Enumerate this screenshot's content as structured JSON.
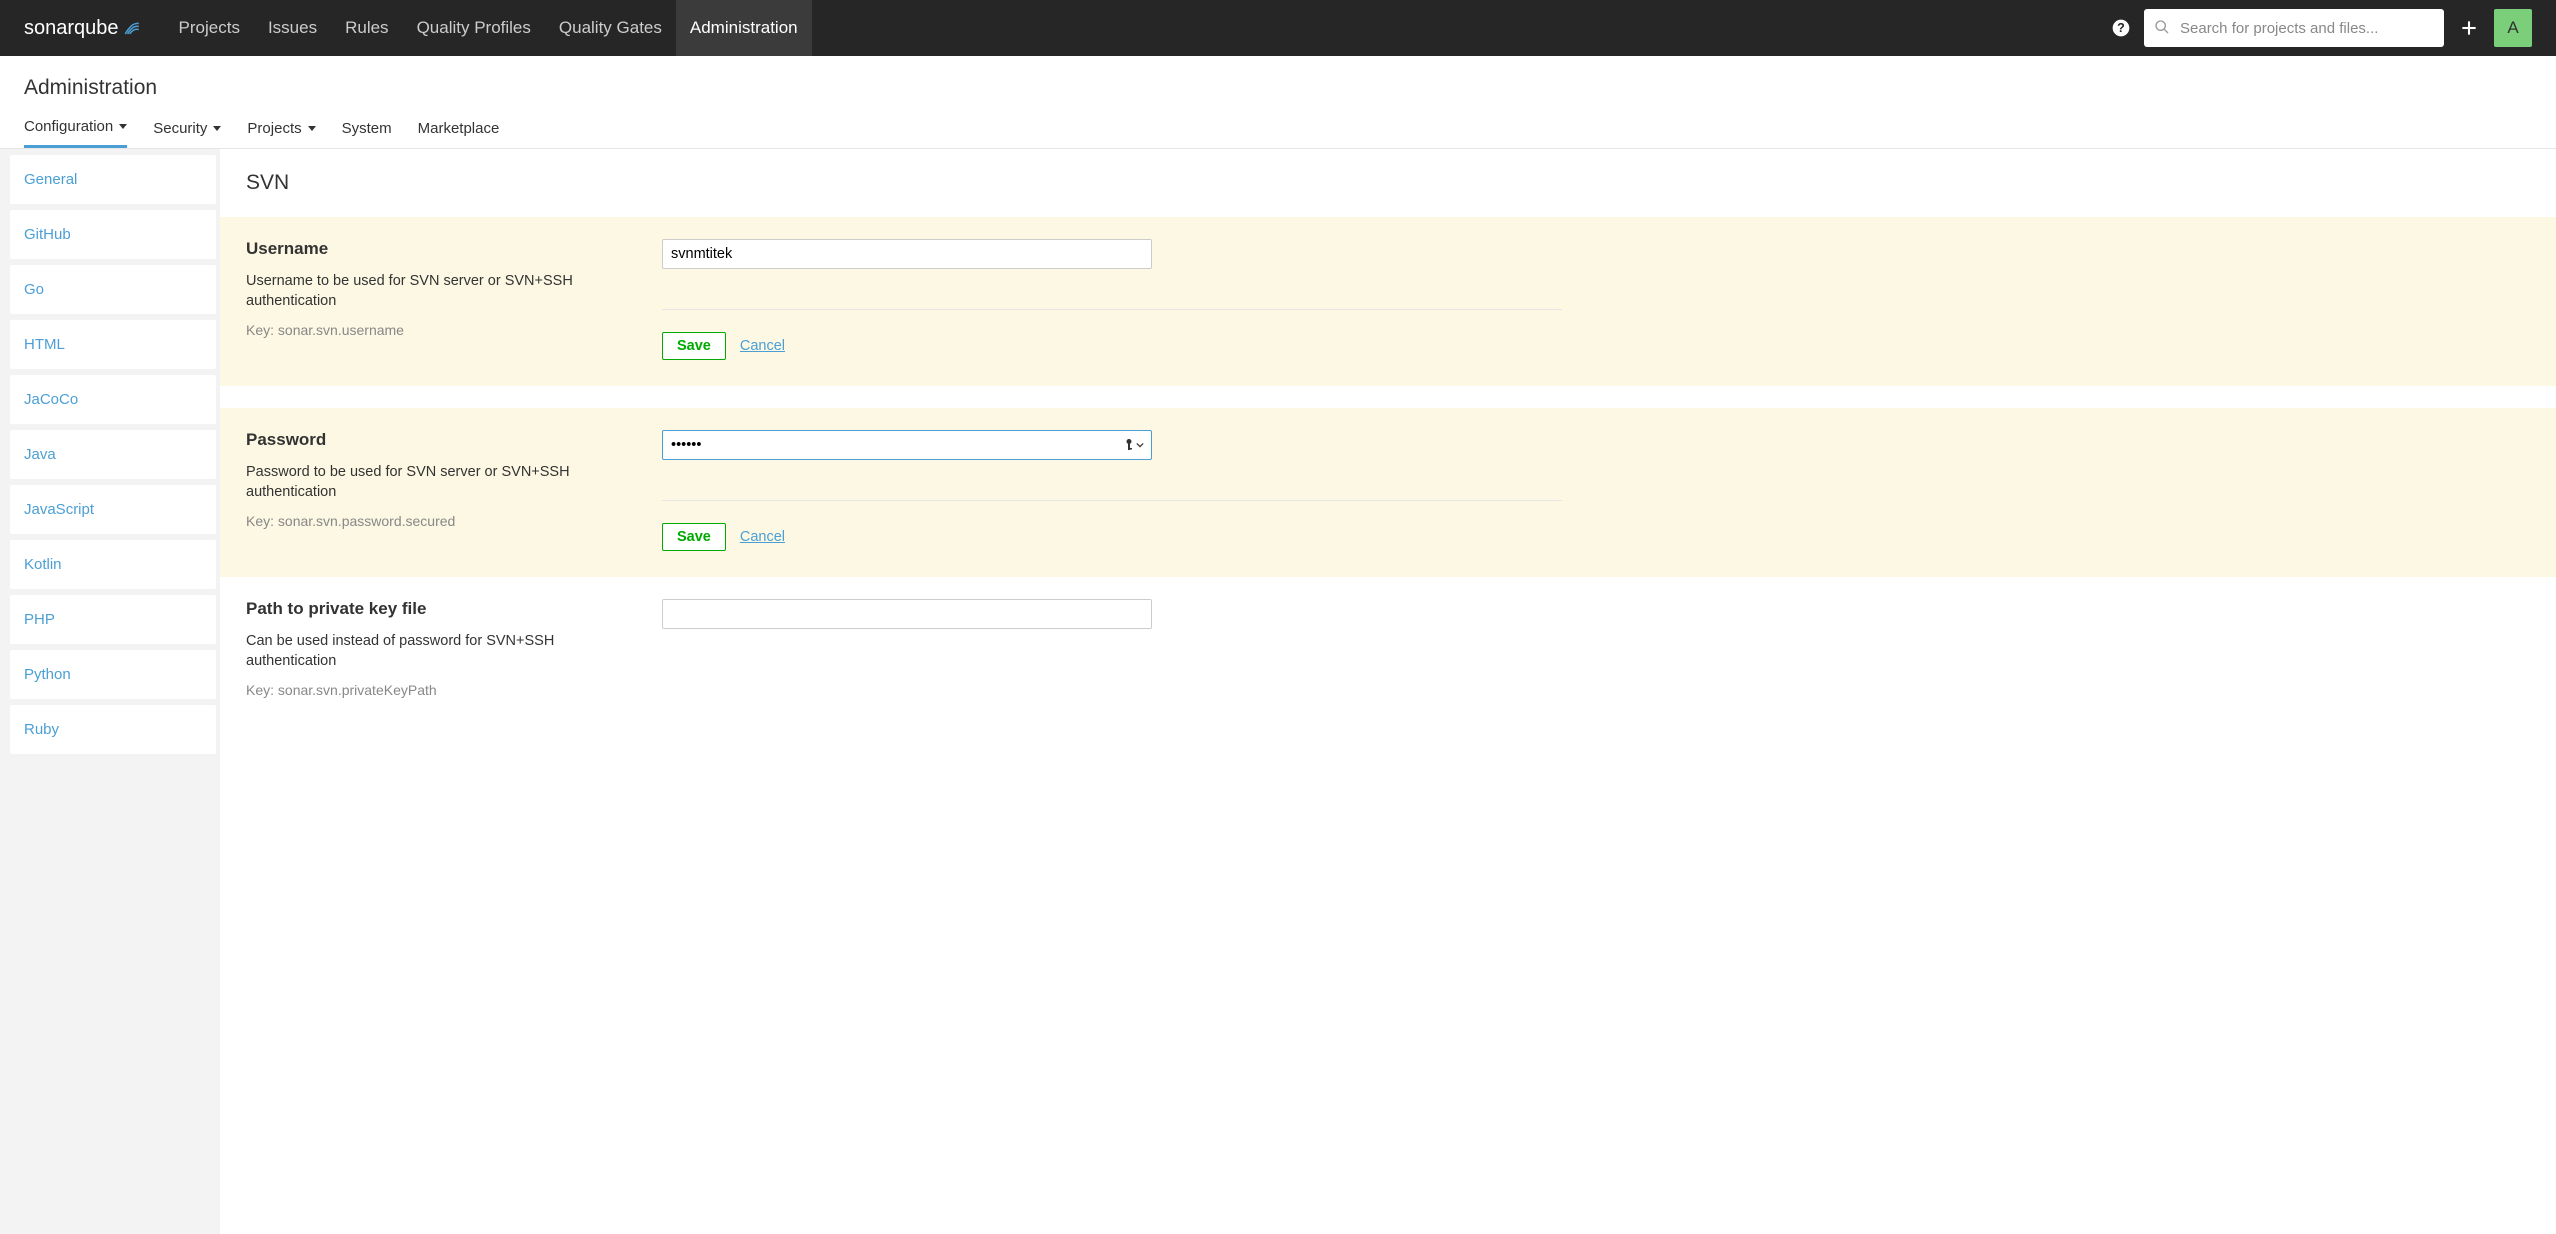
{
  "topnav": {
    "logo": {
      "part1": "sonar",
      "part2": "qube"
    },
    "links": [
      "Projects",
      "Issues",
      "Rules",
      "Quality Profiles",
      "Quality Gates",
      "Administration"
    ],
    "active_index": 5,
    "search_placeholder": "Search for projects and files...",
    "avatar_letter": "A"
  },
  "page": {
    "title": "Administration",
    "tabs": [
      {
        "label": "Configuration",
        "caret": true,
        "active": true
      },
      {
        "label": "Security",
        "caret": true
      },
      {
        "label": "Projects",
        "caret": true
      },
      {
        "label": "System"
      },
      {
        "label": "Marketplace"
      }
    ]
  },
  "sidebar": {
    "items": [
      "General",
      "GitHub",
      "Go",
      "HTML",
      "JaCoCo",
      "Java",
      "JavaScript",
      "Kotlin",
      "PHP",
      "Python",
      "Ruby"
    ]
  },
  "section": {
    "title": "SVN"
  },
  "settings": [
    {
      "highlighted": true,
      "name": "Username",
      "desc": "Username to be used for SVN server or SVN+SSH authentication",
      "key_label": "Key: sonar.svn.username",
      "value": "svnmtitek",
      "type": "text",
      "save": "Save",
      "cancel": "Cancel",
      "has_actions": true
    },
    {
      "highlighted": true,
      "name": "Password",
      "desc": "Password to be used for SVN server or SVN+SSH authentication",
      "key_label": "Key: sonar.svn.password.secured",
      "value": "••••••",
      "type": "password",
      "focused": true,
      "save": "Save",
      "cancel": "Cancel",
      "has_actions": true
    },
    {
      "highlighted": false,
      "name": "Path to private key file",
      "desc": "Can be used instead of password for SVN+SSH authentication",
      "key_label": "Key: sonar.svn.privateKeyPath",
      "value": "",
      "type": "text",
      "has_actions": false
    }
  ]
}
